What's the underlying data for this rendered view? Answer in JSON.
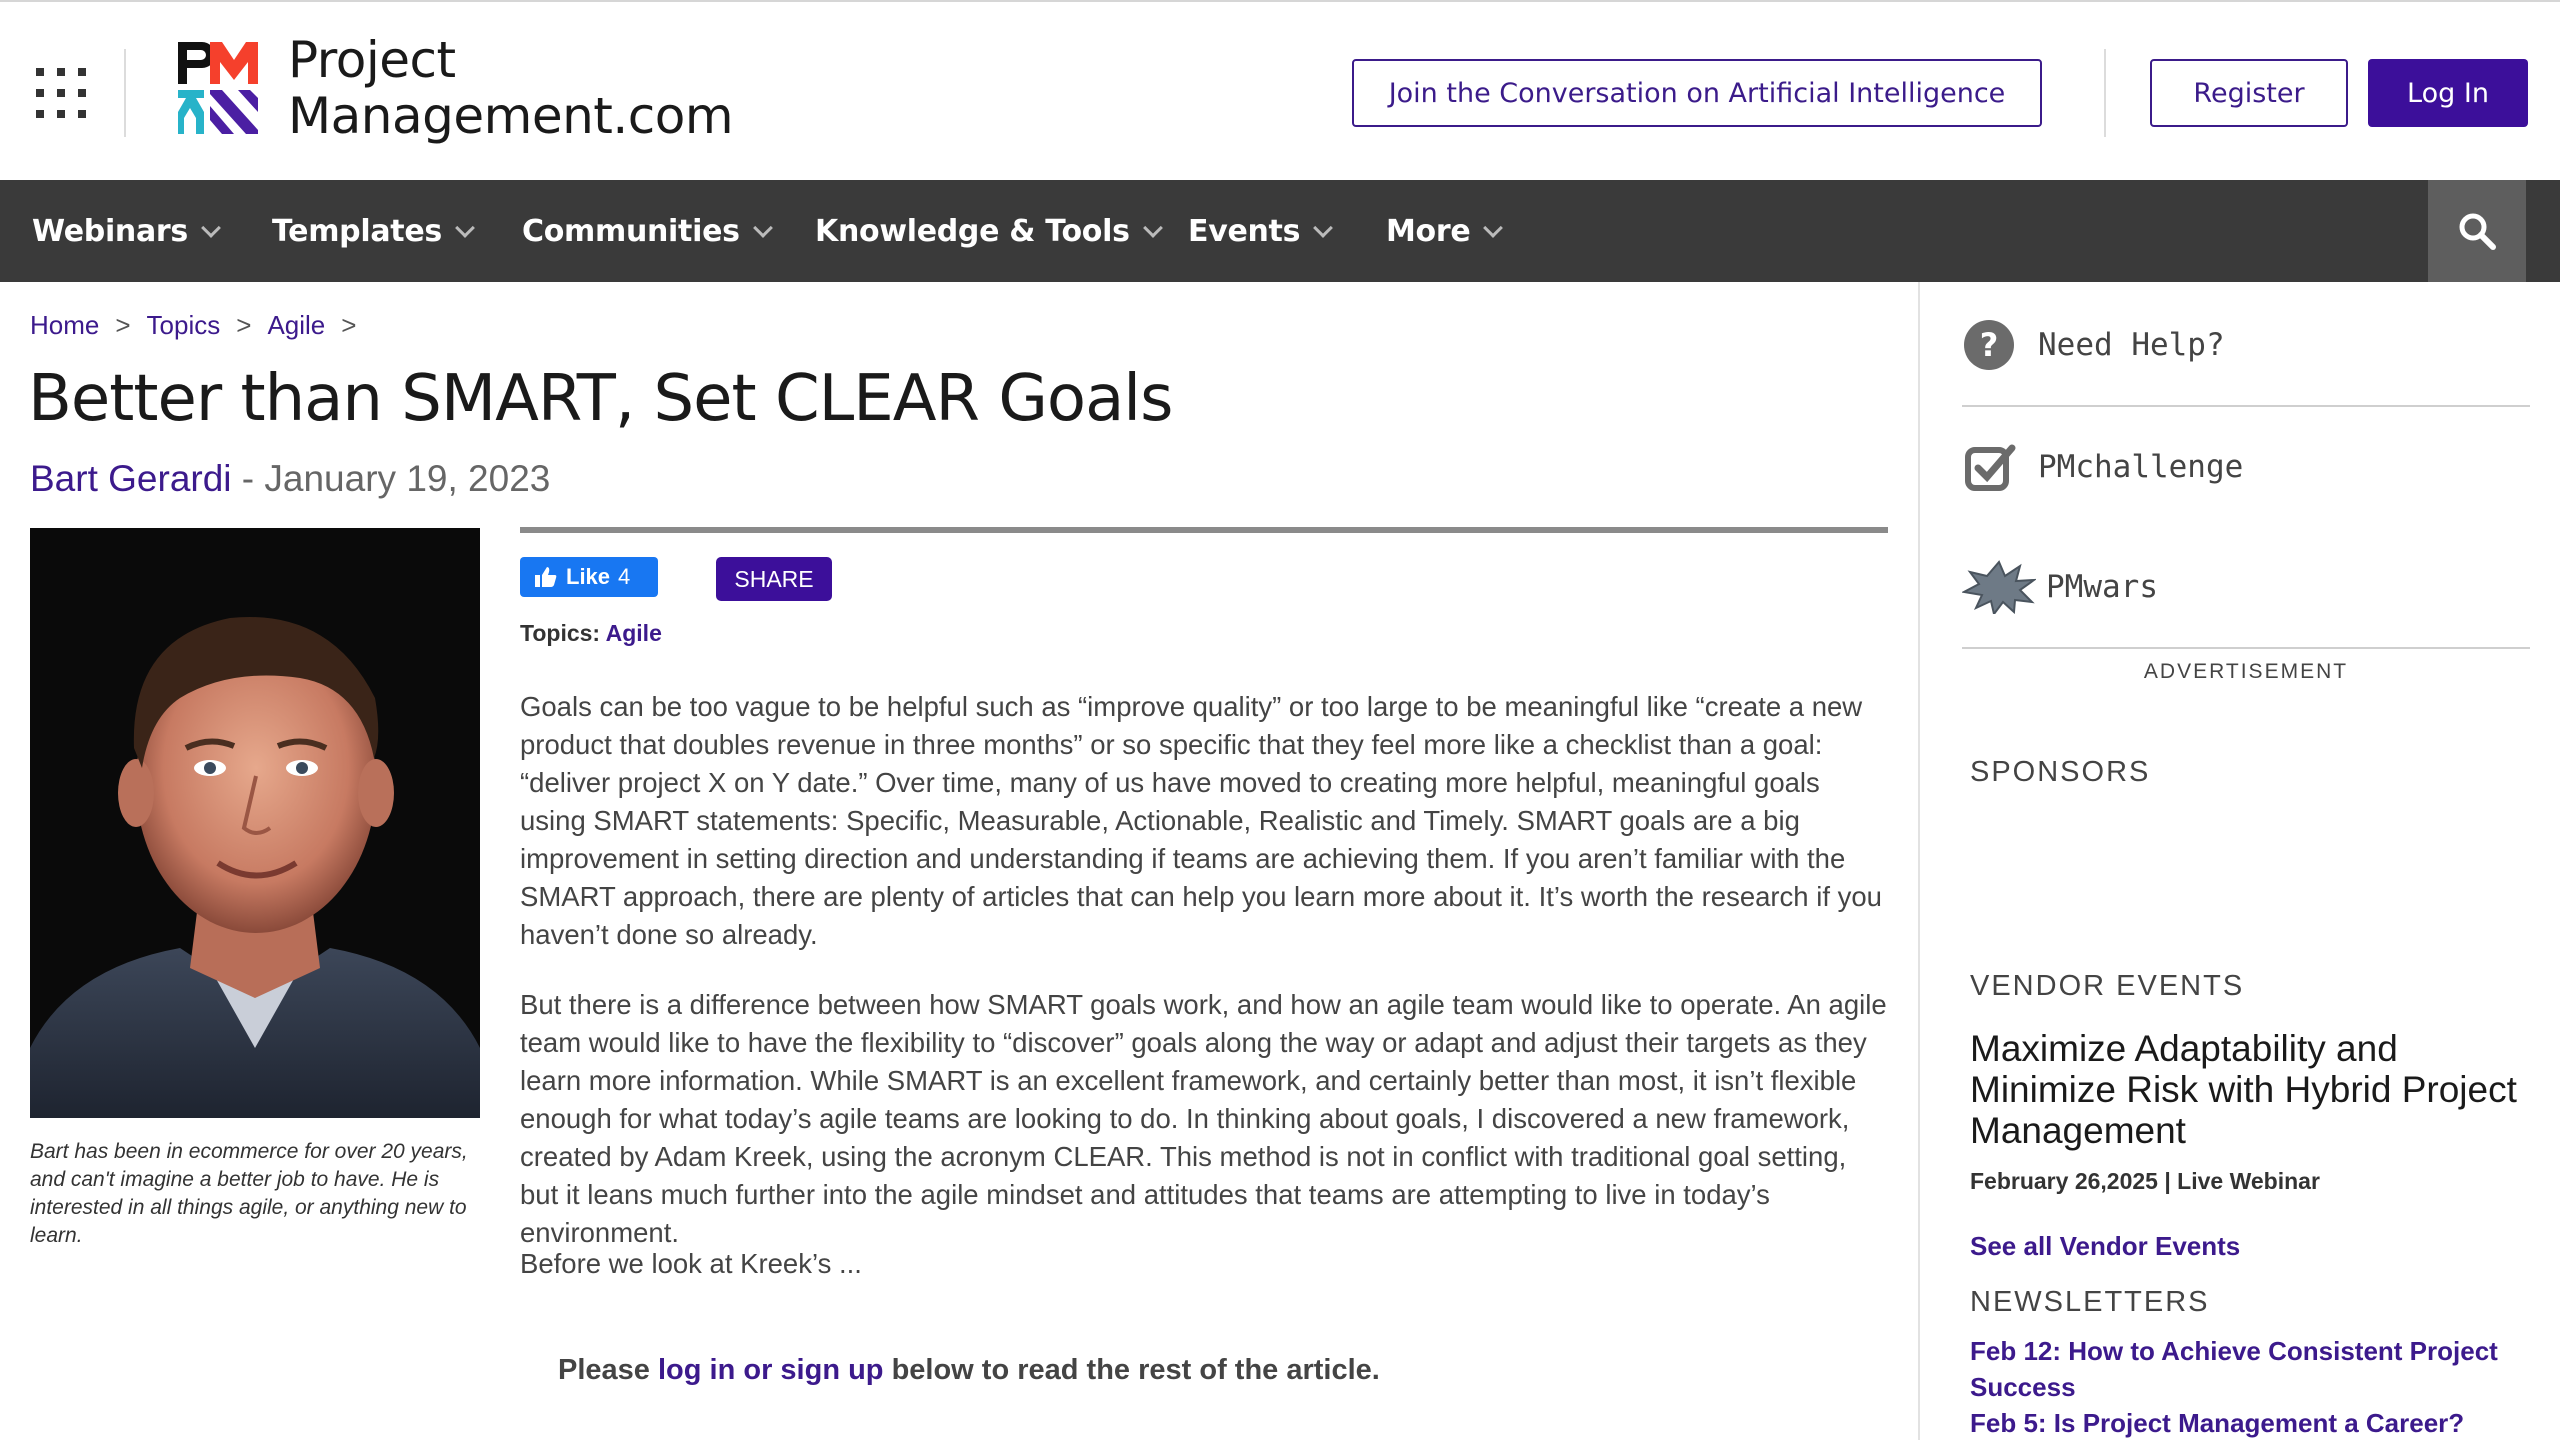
{
  "header": {
    "logo_line1": "Project",
    "logo_line2": "Management.com",
    "cta_ai": "Join the Conversation on Artificial Intelligence",
    "register": "Register",
    "login": "Log In"
  },
  "nav": {
    "items": [
      {
        "label": "Webinars"
      },
      {
        "label": "Templates"
      },
      {
        "label": "Communities"
      },
      {
        "label": "Knowledge & Tools"
      },
      {
        "label": "Events"
      },
      {
        "label": "More"
      }
    ]
  },
  "breadcrumb": [
    "Home",
    "Topics",
    "Agile"
  ],
  "article": {
    "title": "Better than SMART, Set CLEAR Goals",
    "author": "Bart Gerardi",
    "date_sep": " - ",
    "date": "January 19, 2023",
    "author_caption": "Bart has been in ecommerce for over 20 years, and can't imagine a better job to have. He is interested in all things agile, or anything new to learn.",
    "like_label": "Like",
    "like_count": "4",
    "share_label": "SHARE",
    "topics_label": "Topics: ",
    "topic": "Agile",
    "paragraphs": [
      "Goals can be too vague to be helpful such as “improve quality” or too large to be meaningful like “create a new product that doubles revenue in three months” or so specific that they feel more like a checklist than a goal: “deliver project X on Y date.” Over time, many of us have moved to creating more helpful, meaningful goals using SMART statements: Specific, Measurable, Actionable, Realistic and Timely. SMART goals are a big improvement in setting direction and understanding if teams are achieving them. If you aren’t familiar with the SMART approach, there are plenty of articles that can help you learn more about it. It’s worth the research if you haven’t done so already.",
      "But there is a difference between how SMART goals work, and how an agile team would like to operate. An agile team would like to have the flexibility to “discover” goals along the way or adapt and adjust their targets as they learn more information. While SMART is an excellent framework, and certainly better than most, it isn’t flexible enough for what today’s agile teams are looking to do. In thinking about goals, I discovered a new framework, created by Adam Kreek, using the acronym CLEAR. This method is not in conflict with traditional goal setting, but it leans much further into the agile mindset and attitudes that teams are attempting to live in today’s environment.",
      "Before we look at Kreek’s ..."
    ],
    "login_prefix": "Please ",
    "login_link": "log in or sign up",
    "login_suffix": " below to read the rest of the article."
  },
  "sidebar": {
    "help": "Need Help?",
    "challenge": "PMchallenge",
    "wars": "PMwars",
    "advertisement": "ADVERTISEMENT",
    "sponsors": "SPONSORS",
    "vendor_events_heading": "VENDOR EVENTS",
    "event_title": "Maximize Adaptability and Minimize Risk with Hybrid Project Management",
    "event_meta": "February 26,2025 | Live Webinar",
    "see_all_events": "See all Vendor Events",
    "newsletters_heading": "NEWSLETTERS",
    "newsletters": [
      "Feb 12: How to Achieve Consistent Project Success",
      "Feb 5: Is Project Management a Career?"
    ]
  },
  "colors": {
    "brand_purple": "#3c0f9a",
    "nav_bg": "#3a3a3a",
    "link": "#3c1a8c",
    "facebook_blue": "#1877f2"
  }
}
